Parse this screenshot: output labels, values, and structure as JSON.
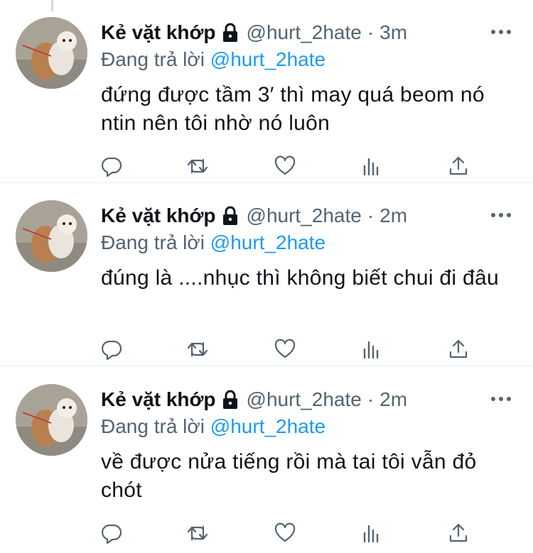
{
  "tweets": [
    {
      "name": "Kẻ vặt khớp",
      "handle": "@hurt_2hate",
      "separator": "·",
      "time": "3m",
      "reply_prefix": "Đang trả lời",
      "reply_mention": "@hurt_2hate",
      "text": "đứng được tầm 3′ thì may quá beom nó ntin nên tôi nhờ nó luôn"
    },
    {
      "name": "Kẻ vặt khớp",
      "handle": "@hurt_2hate",
      "separator": "·",
      "time": "2m",
      "reply_prefix": "Đang trả lời",
      "reply_mention": "@hurt_2hate",
      "text": "đúng là ....nhục thì không biết chui đi đâu"
    },
    {
      "name": "Kẻ vặt khớp",
      "handle": "@hurt_2hate",
      "separator": "·",
      "time": "2m",
      "reply_prefix": "Đang trả lời",
      "reply_mention": "@hurt_2hate",
      "text": "về được nửa tiếng rồi mà tai tôi vẫn đỏ chót"
    }
  ],
  "icons": {
    "lock": "lock-icon",
    "more": "more-icon",
    "reply": "reply-icon",
    "retweet": "retweet-icon",
    "like": "heart-icon",
    "views": "analytics-icon",
    "share": "share-icon"
  },
  "colors": {
    "text": "#0f1419",
    "secondary": "#536471",
    "mention": "#1d9bf0",
    "divider": "#e6ecf0"
  }
}
